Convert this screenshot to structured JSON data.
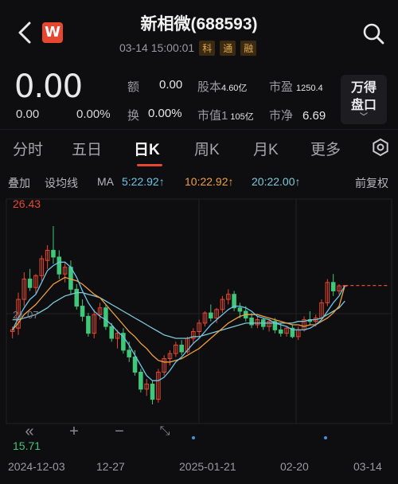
{
  "header": {
    "title": "新相微(688593)",
    "datetime": "03-14 15:00:01",
    "tags": [
      "科",
      "通",
      "融"
    ],
    "logo_letter": "W"
  },
  "quote": {
    "price": "0.00",
    "change": "0.00",
    "change_pct": "0.00%",
    "stats": {
      "volume_label": "额",
      "volume_value": "0.00",
      "equity_label": "股本",
      "equity_value": "4.60亿",
      "pe_label": "市盈",
      "pe_value": "1250.4",
      "turnover_label": "换",
      "turnover_value": "0.00%",
      "mktcap_label": "市值1",
      "mktcap_value": "105亿",
      "pb_label": "市净",
      "pb_value": "6.69"
    },
    "panel_button": [
      "万得",
      "盘口"
    ]
  },
  "tabs": [
    "分时",
    "五日",
    "日K",
    "周K",
    "月K",
    "更多"
  ],
  "ma_row": {
    "overlay": "叠加",
    "set_ma": "设均线",
    "ma": "MA",
    "ma5": "5:22.92↑",
    "ma10": "10:22.92↑",
    "ma20": "20:22.00↑",
    "adjust": "前复权"
  },
  "colors": {
    "up": "#e8472f",
    "down": "#3fc77a",
    "ma5": "#6cc6e8",
    "ma10": "#f0a040",
    "ma20": "#7fc8d8",
    "accent": "#e8472f"
  },
  "chart_data": {
    "type": "candlestick",
    "high_label": "26.43",
    "low_label": "15.71",
    "mid_label": "21.07",
    "ylim": [
      15.71,
      26.43
    ],
    "x_ticks": [
      "2024-12-03",
      "12-27",
      "2025-01-21",
      "02-20",
      "03-14"
    ],
    "candles": [
      [
        20.2,
        20.5,
        19.8,
        20.3
      ],
      [
        20.4,
        22.5,
        20.0,
        22.1
      ],
      [
        22.1,
        23.7,
        21.7,
        23.3
      ],
      [
        23.3,
        23.9,
        22.6,
        22.8
      ],
      [
        22.8,
        23.6,
        22.4,
        23.5
      ],
      [
        23.5,
        24.7,
        23.2,
        24.5
      ],
      [
        24.4,
        25.3,
        23.9,
        25.0
      ],
      [
        25.0,
        26.43,
        24.2,
        24.6
      ],
      [
        24.6,
        25.0,
        23.3,
        23.6
      ],
      [
        23.6,
        24.3,
        23.1,
        24.0
      ],
      [
        24.0,
        24.4,
        22.4,
        22.7
      ],
      [
        22.7,
        23.0,
        21.5,
        21.7
      ],
      [
        21.7,
        22.1,
        20.8,
        21.1
      ],
      [
        21.1,
        21.3,
        19.9,
        20.1
      ],
      [
        20.1,
        21.5,
        19.8,
        21.2
      ],
      [
        21.2,
        21.9,
        20.9,
        21.6
      ],
      [
        21.6,
        21.8,
        20.3,
        20.5
      ],
      [
        20.5,
        20.7,
        19.6,
        19.8
      ],
      [
        19.8,
        20.3,
        19.2,
        20.1
      ],
      [
        20.1,
        20.4,
        18.9,
        19.1
      ],
      [
        19.1,
        19.6,
        18.4,
        18.7
      ],
      [
        18.7,
        19.1,
        17.6,
        17.8
      ],
      [
        17.8,
        18.0,
        16.6,
        16.8
      ],
      [
        16.8,
        17.4,
        16.4,
        17.1
      ],
      [
        17.1,
        17.3,
        15.9,
        16.2
      ],
      [
        16.2,
        18.0,
        16.0,
        17.8
      ],
      [
        17.8,
        18.8,
        17.6,
        18.6
      ],
      [
        18.6,
        19.1,
        18.2,
        18.9
      ],
      [
        18.9,
        19.6,
        18.7,
        19.4
      ],
      [
        19.4,
        19.7,
        18.8,
        19.0
      ],
      [
        19.0,
        19.9,
        18.9,
        19.8
      ],
      [
        19.8,
        20.4,
        19.5,
        20.2
      ],
      [
        20.2,
        20.9,
        19.9,
        20.7
      ],
      [
        20.7,
        21.4,
        20.5,
        21.3
      ],
      [
        21.3,
        21.8,
        20.8,
        21.0
      ],
      [
        21.0,
        21.6,
        20.7,
        21.5
      ],
      [
        21.5,
        22.3,
        21.3,
        22.1
      ],
      [
        22.1,
        22.7,
        21.8,
        22.4
      ],
      [
        22.4,
        22.6,
        21.4,
        21.6
      ],
      [
        21.6,
        21.9,
        21.0,
        21.4
      ],
      [
        21.4,
        21.7,
        20.8,
        21.0
      ],
      [
        21.0,
        21.3,
        20.4,
        20.6
      ],
      [
        20.6,
        21.1,
        20.4,
        20.9
      ],
      [
        20.9,
        21.0,
        20.3,
        20.5
      ],
      [
        20.5,
        20.9,
        20.2,
        20.8
      ],
      [
        20.8,
        21.0,
        20.1,
        20.3
      ],
      [
        20.3,
        20.7,
        19.9,
        20.1
      ],
      [
        20.1,
        20.5,
        19.9,
        20.4
      ],
      [
        20.4,
        20.6,
        19.8,
        19.9
      ],
      [
        19.9,
        20.5,
        19.7,
        20.3
      ],
      [
        20.3,
        21.1,
        20.2,
        20.9
      ],
      [
        20.9,
        21.4,
        20.6,
        20.8
      ],
      [
        20.8,
        21.2,
        20.5,
        21.0
      ],
      [
        21.0,
        22.1,
        20.9,
        21.9
      ],
      [
        21.9,
        23.3,
        21.7,
        23.1
      ],
      [
        23.1,
        23.6,
        22.3,
        22.6
      ],
      [
        22.6,
        23.0,
        22.4,
        22.9
      ],
      [
        22.9,
        22.92,
        22.9,
        22.92
      ]
    ],
    "ma5": [
      20.3,
      21.0,
      21.6,
      22.1,
      22.4,
      23.1,
      23.8,
      24.1,
      24.3,
      24.3,
      24.0,
      23.4,
      22.6,
      21.9,
      21.4,
      21.1,
      20.9,
      20.6,
      20.2,
      19.9,
      19.4,
      18.8,
      18.2,
      17.6,
      17.3,
      17.3,
      17.5,
      17.9,
      18.4,
      18.7,
      19.1,
      19.5,
      19.8,
      20.2,
      20.6,
      20.9,
      21.2,
      21.5,
      21.7,
      21.7,
      21.6,
      21.4,
      21.1,
      21.0,
      20.9,
      20.7,
      20.6,
      20.5,
      20.3,
      20.3,
      20.3,
      20.4,
      20.6,
      20.9,
      21.4,
      21.9,
      22.3,
      22.92
    ],
    "ma10": [
      20.3,
      20.7,
      21.2,
      21.5,
      21.8,
      22.2,
      22.6,
      23.0,
      23.2,
      23.4,
      23.3,
      23.2,
      23.0,
      22.7,
      22.4,
      22.2,
      21.8,
      21.4,
      21.0,
      20.6,
      20.2,
      19.9,
      19.5,
      19.2,
      18.8,
      18.5,
      18.4,
      18.4,
      18.5,
      18.6,
      18.8,
      19.0,
      19.2,
      19.5,
      19.8,
      20.1,
      20.4,
      20.7,
      20.9,
      21.1,
      21.2,
      21.2,
      21.2,
      21.1,
      21.0,
      20.9,
      20.8,
      20.7,
      20.6,
      20.6,
      20.5,
      20.6,
      20.6,
      20.8,
      21.0,
      21.3,
      21.7,
      22.92
    ],
    "ma20": [
      20.9,
      20.9,
      21.0,
      21.1,
      21.2,
      21.4,
      21.6,
      21.9,
      22.1,
      22.3,
      22.4,
      22.5,
      22.5,
      22.4,
      22.3,
      22.2,
      22.0,
      21.8,
      21.6,
      21.4,
      21.2,
      21.0,
      20.8,
      20.6,
      20.4,
      20.2,
      20.0,
      19.9,
      19.8,
      19.8,
      19.8,
      19.9,
      19.9,
      20.0,
      20.1,
      20.2,
      20.3,
      20.4,
      20.5,
      20.6,
      20.7,
      20.7,
      20.7,
      20.7,
      20.7,
      20.7,
      20.7,
      20.7,
      20.7,
      20.8,
      20.8,
      20.9,
      20.9,
      21.0,
      21.2,
      21.4,
      21.6,
      22.0
    ]
  }
}
